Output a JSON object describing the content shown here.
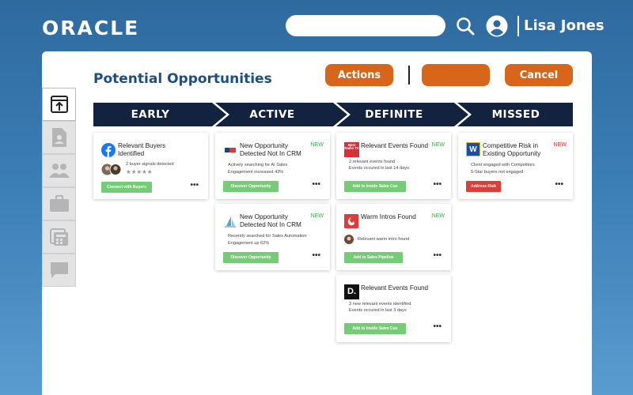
{
  "header": {
    "logo_text": "ORACLE",
    "search_placeholder": "",
    "user_name": "Lisa Jones"
  },
  "page": {
    "title": "Potential Opportunities",
    "actions_label": "Actions",
    "blank_label": "",
    "cancel_label": "Cancel"
  },
  "sidebar": {
    "items": [
      {
        "icon": "upload-icon",
        "active": true
      },
      {
        "icon": "document-icon",
        "active": false
      },
      {
        "icon": "users-icon",
        "active": false
      },
      {
        "icon": "briefcase-icon",
        "active": false
      },
      {
        "icon": "calculator-icon",
        "active": false
      },
      {
        "icon": "chat-icon",
        "active": false
      }
    ]
  },
  "stages": [
    "EARLY",
    "ACTIVE",
    "DEFINITE",
    "MISSED"
  ],
  "cards": {
    "early": {
      "title": "Relevant Buyers Identified",
      "line1": "2 buyer signals detected",
      "stars": "★★★★★",
      "button": "Connect with Buyers",
      "more": "•••"
    },
    "active1": {
      "title": "New Opportunity Detected Not In CRM",
      "badge": "NEW",
      "line1": "Actively searching for AI Sales",
      "line2": "Engagement increased 43%",
      "button": "Discover Opportunity",
      "more": "•••"
    },
    "active2": {
      "title": "New Opportunity Detected Not In CRM",
      "badge": "NEW",
      "line1": "Recently searched for Sales Automation",
      "line2": "Engagement up 62%",
      "button": "Discover Opportunity",
      "more": "•••"
    },
    "definite1": {
      "title": "Relevant Events Found",
      "badge": "NEW",
      "logo_text": "Best Radio TV",
      "line1": "2 relevant events found",
      "line2": "Events occured in last 14 days",
      "button": "Add to Inside Sales Cue",
      "more": "•••"
    },
    "definite2": {
      "title": "Warm Intros Found",
      "badge": "NEW",
      "line1": "Relevant warm intro found",
      "button": "Add to Sales Pipeline",
      "more": "•••"
    },
    "definite3": {
      "title": "Relevant Events Found",
      "logo_text": "D.",
      "line1": "3 new relevant events identified",
      "line2": "Events occured in last 3 days",
      "button": "Add to Inside Sales Cue",
      "more": "•••"
    },
    "missed": {
      "title": "Competitive Risk in Existing Opportunity",
      "badge": "NEW",
      "logo_text": "W",
      "line1": "Client engaged with Competitors",
      "line2": "5-Star buyers not engaged",
      "button": "Address Risk",
      "more": "•••"
    }
  },
  "colors": {
    "accent_orange": "#d8661a",
    "stage_navy": "#13233f",
    "title_blue": "#1d4e7e",
    "new_green": "#36a94a",
    "new_red": "#e02424",
    "button_green": "#74cc74",
    "button_red": "#e03c36"
  }
}
